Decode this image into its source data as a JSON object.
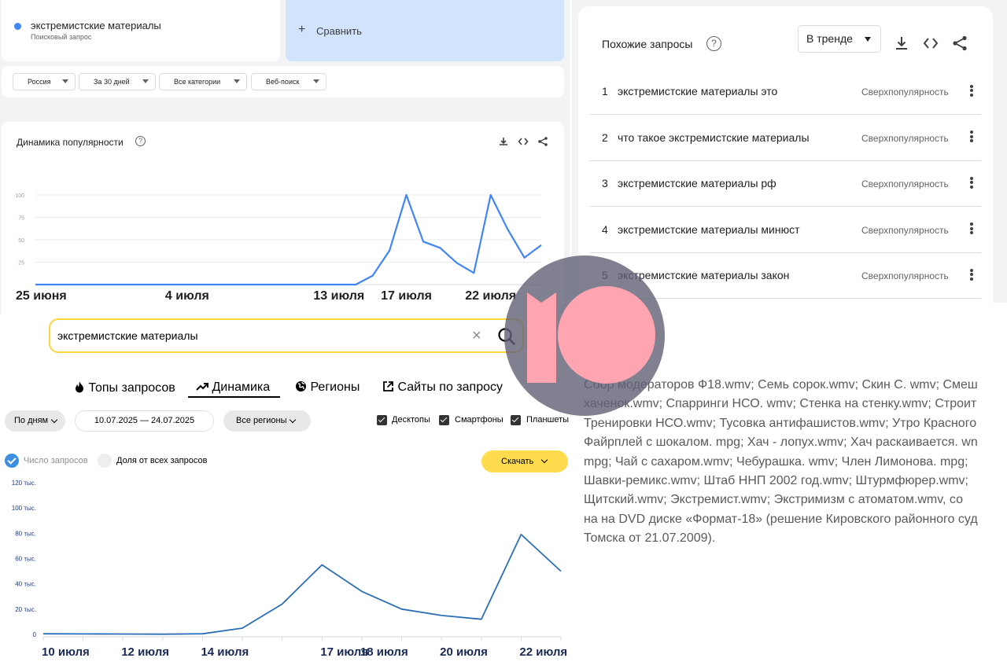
{
  "google_trends": {
    "search_term": "экстремистские материалы",
    "search_term_type": "Поисковый запрос",
    "compare_label": "Сравнить",
    "filters": [
      "Россия",
      "За 30 дней",
      "Все категории",
      "Веб-поиск"
    ],
    "interest_title": "Динамика популярности",
    "accent_color": "#4285f4"
  },
  "related_queries": {
    "title": "Похожие запросы",
    "sort_select": "В тренде",
    "items": [
      {
        "rank": "1",
        "query": "экстремистские материалы это",
        "popularity": "Сверхпопулярность"
      },
      {
        "rank": "2",
        "query": "что такое экстремистские материалы",
        "popularity": "Сверхпопулярность"
      },
      {
        "rank": "3",
        "query": "экстремистские материалы рф",
        "popularity": "Сверхпопулярность"
      },
      {
        "rank": "4",
        "query": "экстремистские материалы минюст",
        "popularity": "Сверхпопулярность"
      },
      {
        "rank": "5",
        "query": "экстремистские материалы закон",
        "popularity": "Сверхпопулярность"
      }
    ]
  },
  "wordstat": {
    "search_value": "экстремистские материалы",
    "tabs": [
      {
        "label": "Топы запросов",
        "icon": "fire-icon",
        "active": false
      },
      {
        "label": "Динамика",
        "icon": "trending-up-icon",
        "active": true
      },
      {
        "label": "Регионы",
        "icon": "globe-icon",
        "active": false
      },
      {
        "label": "Сайты по запросу",
        "icon": "external-link-icon",
        "active": false
      }
    ],
    "period_select": "По дням",
    "date_range": "10.07.2025 — 24.07.2025",
    "region_select": "Все регионы",
    "devices": [
      {
        "label": "Десктопы",
        "checked": true
      },
      {
        "label": "Смартфоны",
        "checked": true
      },
      {
        "label": "Планшеты",
        "checked": true
      }
    ],
    "metric_options": [
      {
        "label": "Число запросов",
        "selected": true
      },
      {
        "label": "Доля от всех запросов",
        "selected": false
      }
    ],
    "download_label": "Скачать",
    "accent_color": "#ffdb4d"
  },
  "text_list": {
    "lines": [
      "Сбор модераторов Ф18.wmv; Семь сорок.wmv; Скин С. wmv; Смеш",
      "хаченок.wmv; Спарринги НСО. wmv; Стенка на стенку.wmv; Строит",
      "Тренировки НСО.wmv; Тусовка антифашистов.wmv; Утро Красного",
      "Файрплей с шокалом. mpg; Хач - лопух.wmv; Хач раскаивается. wn",
      "mpg; Чай с сахаром.wmv; Чебурашка. wmv; Член Лимонова. mpg;",
      "Шавки-ремикс.wmv; Штаб ННП 2002 год.wmv; Штурмфюрер.wmv;",
      "Щитский.wmv; Экстремист.wmv; Экстримизм с атоматом.wmv, со",
      "на на DVD диске «Формат-18» (решение Кировского районного суд",
      "Томска от 21.07.2009)."
    ]
  },
  "watermark": {
    "logo": "10-logo-icon",
    "color": "#ffa4b0"
  },
  "chart_data": [
    {
      "type": "line",
      "title": "Динамика популярности",
      "x_tick_labels": [
        "25 июня",
        "4 июля",
        "13 июля",
        "17 июля",
        "22 июля"
      ],
      "x_tick_index": [
        0,
        9,
        18,
        22,
        27
      ],
      "y_ticks": [
        25,
        50,
        75,
        100
      ],
      "ylim": [
        0,
        100
      ],
      "grid": true,
      "series": [
        {
          "values": [
            0,
            0,
            0,
            0,
            0,
            0,
            0,
            0,
            0,
            0,
            0,
            0,
            0,
            0,
            0,
            0,
            0,
            0,
            0,
            0,
            10,
            38,
            100,
            48,
            41,
            24,
            13,
            100,
            62,
            30,
            44
          ]
        }
      ]
    },
    {
      "type": "line",
      "x": [
        "10 июля",
        "11 июля",
        "12 июля",
        "13 июля",
        "14 июля",
        "15 июля",
        "16 июля",
        "17 июля",
        "18 июля",
        "19 июля",
        "20 июля",
        "21 июля",
        "22 июля",
        "23 июля"
      ],
      "x_tick_labels": [
        "10 июля",
        "12 июля",
        "14 июля",
        "17 июля",
        "18 июля",
        "20 июля",
        "22 июля"
      ],
      "y_tick_labels": [
        "0",
        "20 тыс.",
        "40 тыс.",
        "60 тыс.",
        "80 тыс.",
        "100 тыс.",
        "120 тыс."
      ],
      "ylim": [
        0,
        120000
      ],
      "values": [
        500,
        400,
        300,
        200,
        500,
        5000,
        24000,
        55000,
        34000,
        20000,
        15000,
        12000,
        79000,
        50000
      ]
    }
  ]
}
